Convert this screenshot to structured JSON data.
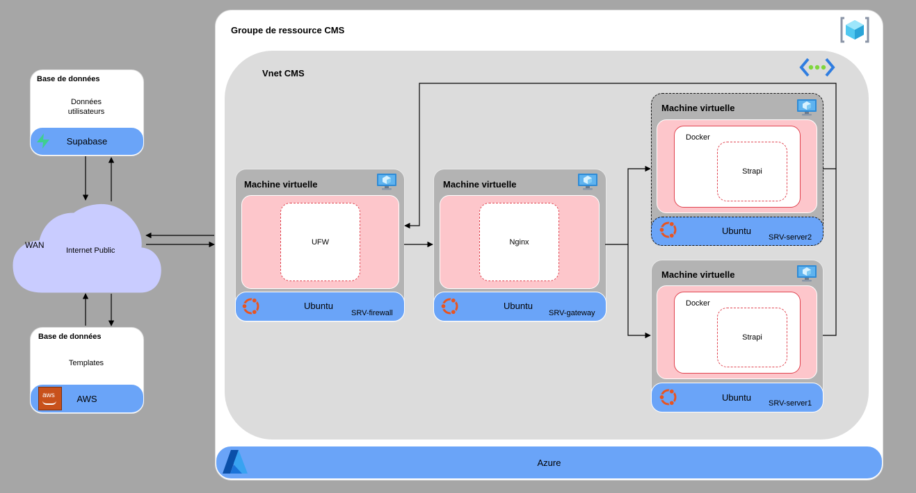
{
  "resource_group": {
    "title": "Groupe de ressource CMS"
  },
  "vnet": {
    "title": "Vnet CMS"
  },
  "platform_bar": {
    "label": "Azure"
  },
  "db_supabase": {
    "title": "Base de données",
    "description": "Données\nutilisateurs",
    "service": "Supabase"
  },
  "db_aws": {
    "title": "Base de données",
    "description": "Templates",
    "service": "AWS",
    "logo_text": "aws"
  },
  "wan": {
    "label": "WAN",
    "cloud_label": "Internet Public"
  },
  "vm_firewall": {
    "title": "Machine virtuelle",
    "component": "UFW",
    "os": "Ubuntu",
    "server_name": "SRV-firewall"
  },
  "vm_gateway": {
    "title": "Machine virtuelle",
    "component": "Nginx",
    "os": "Ubuntu",
    "server_name": "SRV-gateway"
  },
  "vm_server2": {
    "title": "Machine virtuelle",
    "container": "Docker",
    "app": "Strapi",
    "os": "Ubuntu",
    "server_name": "SRV-server2"
  },
  "vm_server1": {
    "title": "Machine virtuelle",
    "container": "Docker",
    "app": "Strapi",
    "os": "Ubuntu",
    "server_name": "SRV-server1"
  },
  "colors": {
    "background": "#a6a6a6",
    "panel_blue": "#6aa4f8",
    "vm_grey": "#b3b3b3",
    "pink": "#fdc6cb",
    "ubuntu_red": "#e95420",
    "cloud": "#c9ccff"
  },
  "icons": [
    "resource-group-icon",
    "vnet-icon",
    "virtual-machine-icon",
    "ubuntu-icon",
    "supabase-icon",
    "aws-icon",
    "azure-icon"
  ]
}
